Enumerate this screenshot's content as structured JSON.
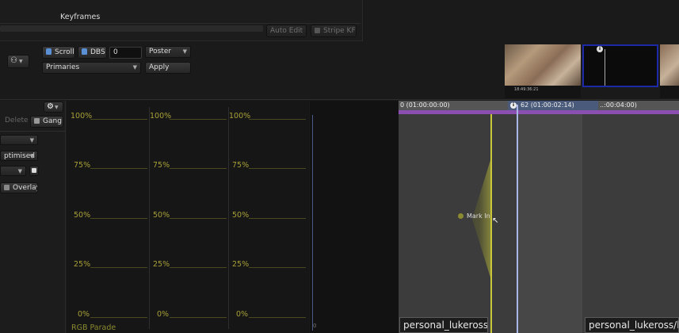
{
  "top_bar": {
    "keyframes_label": "Keyframes",
    "auto_edit_label": "Auto Edit",
    "stripe_kfs_label": "Stripe KFs"
  },
  "controls": {
    "scroll_label": "Scroll",
    "dbs_label": "DBS",
    "dbs_value": "0",
    "poster_option": "Poster",
    "primaries_option": "Primaries",
    "apply_label": "Apply"
  },
  "thumbnails": [
    {
      "timecode": "18:49:36:21",
      "selected": false
    },
    {
      "timecode": "",
      "selected": true
    },
    {
      "timecode": "",
      "selected": false
    }
  ],
  "left_panel": {
    "delete_label": "Delete",
    "gang_label": "Gang",
    "optimised_partial": "ptimised",
    "overlays_label": "Overlays"
  },
  "scopes": {
    "title": "RGB Parade",
    "levels": [
      "100%",
      "75%",
      "50%",
      "25%",
      "0%"
    ]
  },
  "timeline": {
    "start_tc": "0 (01:00:00:00)",
    "playhead_tc": "62 (01:00:02:14)",
    "end_tc_partial": "..:00:04:00)",
    "mark_in_label": "Mark In",
    "clip1_name": "personal_lukeross",
    "clip2_name": "personal_lukeross/l",
    "scope_zero_tick": "0"
  },
  "colors": {
    "accent_blue": "#5a8fd6",
    "selection_blue": "#1c2aa8",
    "scope_yellow": "#a8a038",
    "mark_line": "#c8c83a",
    "playhead": "#aab6e8",
    "purple_strip": "#8a4fb0"
  }
}
